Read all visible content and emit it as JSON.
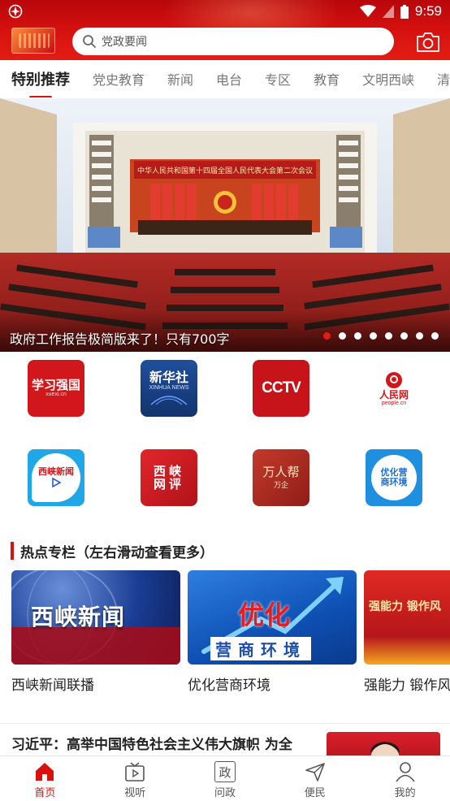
{
  "status_bar": {
    "time": "9:59"
  },
  "search": {
    "placeholder": "党政要闻"
  },
  "tabs": [
    {
      "label": "特别推荐",
      "active": true
    },
    {
      "label": "党史教育"
    },
    {
      "label": "新闻"
    },
    {
      "label": "电台"
    },
    {
      "label": "专区"
    },
    {
      "label": "教育"
    },
    {
      "label": "文明西峡"
    },
    {
      "label": "清"
    }
  ],
  "banner": {
    "caption": "政府工作报告极简版来了！只有700字",
    "slide_count": 8,
    "active_slide": 1,
    "hall_banner_text": "中华人民共和国第十四届全国人民代表大会第二次会议"
  },
  "apps": [
    {
      "name": "学习强国",
      "sub": "xuexi.cn",
      "icon": "xuexi-icon"
    },
    {
      "name": "新华社",
      "sub": "XINHUA NEWS",
      "icon": "xinhua-icon"
    },
    {
      "name": "CCTV",
      "icon": "cctv-icon"
    },
    {
      "name": "人民网",
      "sub": "people.cn",
      "icon": "people-icon"
    },
    {
      "name": "西峡新闻",
      "icon": "xixia-news-icon"
    },
    {
      "name": "西峡网评",
      "icon": "xixia-comment-icon"
    },
    {
      "name": "万人帮",
      "sub": "万企",
      "icon": "wanrenbang-icon"
    },
    {
      "name": "优化营商环境",
      "icon": "business-env-icon"
    }
  ],
  "hot_section": {
    "title": "热点专栏（左右滑动查看更多）",
    "cards": [
      {
        "title": "西峡新闻联播",
        "image_text": "西峡新闻"
      },
      {
        "title": "优化营商环境",
        "image_text_1": "优化",
        "image_text_2": "营商环境"
      },
      {
        "title": "强能力 锻作风 促发展",
        "image_text": "强能力 锻作风"
      }
    ]
  },
  "news": [
    {
      "title": "习近平：高举中国特色社会主义伟大旗帜 为全"
    }
  ],
  "bottom_nav": [
    {
      "label": "首页",
      "icon": "home-icon",
      "active": true
    },
    {
      "label": "视听",
      "icon": "tv-icon"
    },
    {
      "label": "问政",
      "icon": "zheng-icon",
      "glyph": "政"
    },
    {
      "label": "便民",
      "icon": "send-icon"
    },
    {
      "label": "我的",
      "icon": "user-icon"
    }
  ],
  "colors": {
    "brand_red": "#d8120f",
    "header_red": "#c20a0d",
    "active_dot": "#e21d14"
  }
}
